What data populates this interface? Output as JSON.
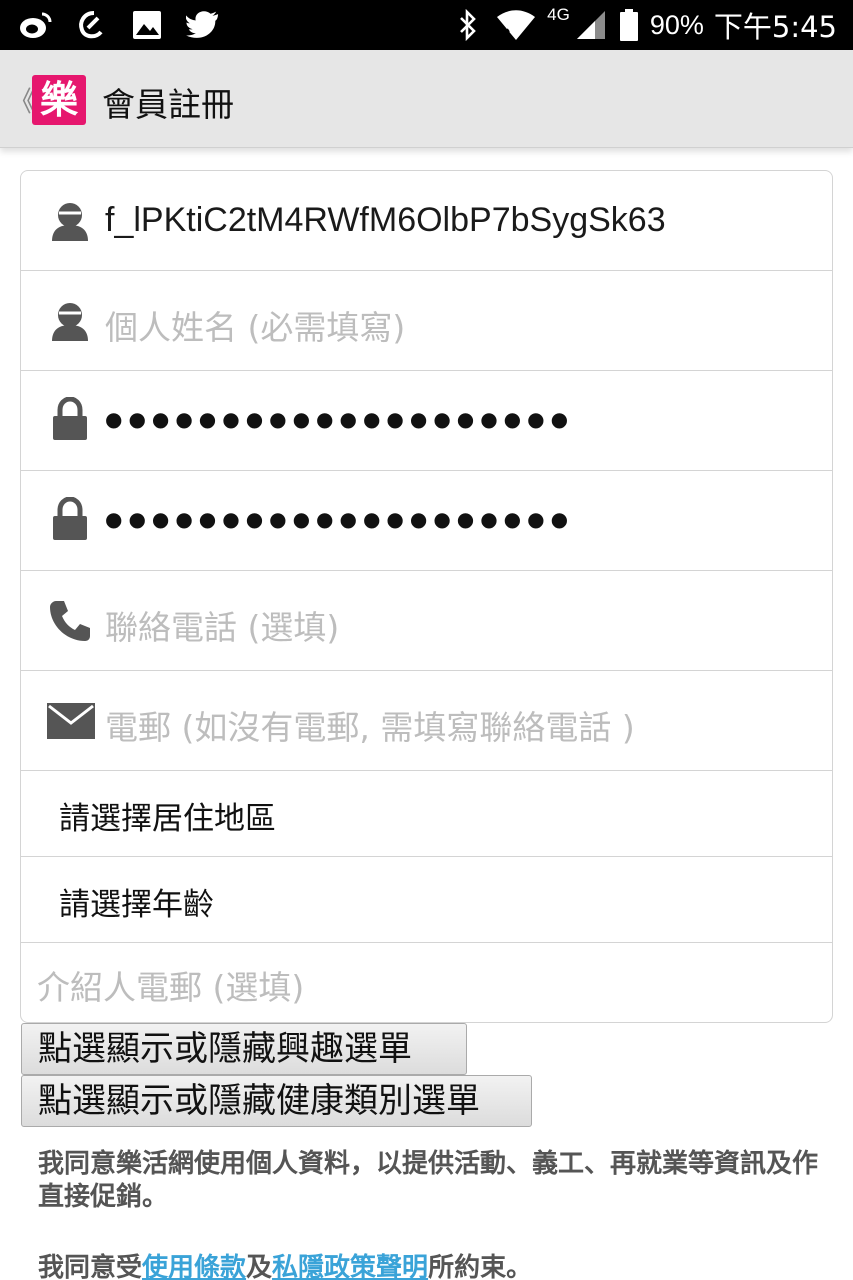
{
  "status_bar": {
    "battery": "90%",
    "time": "下午5:45",
    "network": "4G",
    "icons_left": [
      "weibo-icon",
      "link-app-icon",
      "image-icon",
      "twitter-icon"
    ],
    "icons_right": [
      "bluetooth-icon",
      "wifi-icon",
      "signal-icon",
      "battery-icon"
    ]
  },
  "app_bar": {
    "back_chevron": "《",
    "logo_text": "樂",
    "title": "會員註冊",
    "logo_color": "#e6176e"
  },
  "form": {
    "username_value": "f_lPKtiC2tM4RWfM6OlbP7bSygSk63",
    "name_placeholder": "個人姓名 (必需填寫)",
    "password_dots": "●●●●●●●●●●●●●●●●●●●●",
    "password_confirm_dots": "●●●●●●●●●●●●●●●●●●●●",
    "phone_placeholder": "聯絡電話  (選填)",
    "email_placeholder": "電郵  (如沒有電郵, 需填寫聯絡電話 )",
    "region_select": "請選擇居住地區",
    "age_select": "請選擇年齡",
    "referrer_placeholder": "介紹人電郵 (選填)"
  },
  "buttons": {
    "interest_toggle": "點選顯示或隱藏興趣選單",
    "health_toggle": "點選顯示或隱藏健康類別選單"
  },
  "agreement": {
    "consent_text": "我同意樂活網使用個人資料，以提供活動、義工、再就業等資訊及作直接促銷。",
    "terms_prefix": "我同意受",
    "terms_link": "使用條款",
    "terms_and": "及",
    "privacy_link": "私隱政策聲明",
    "terms_suffix": "所約束。",
    "link_color": "#3aa3d8"
  }
}
